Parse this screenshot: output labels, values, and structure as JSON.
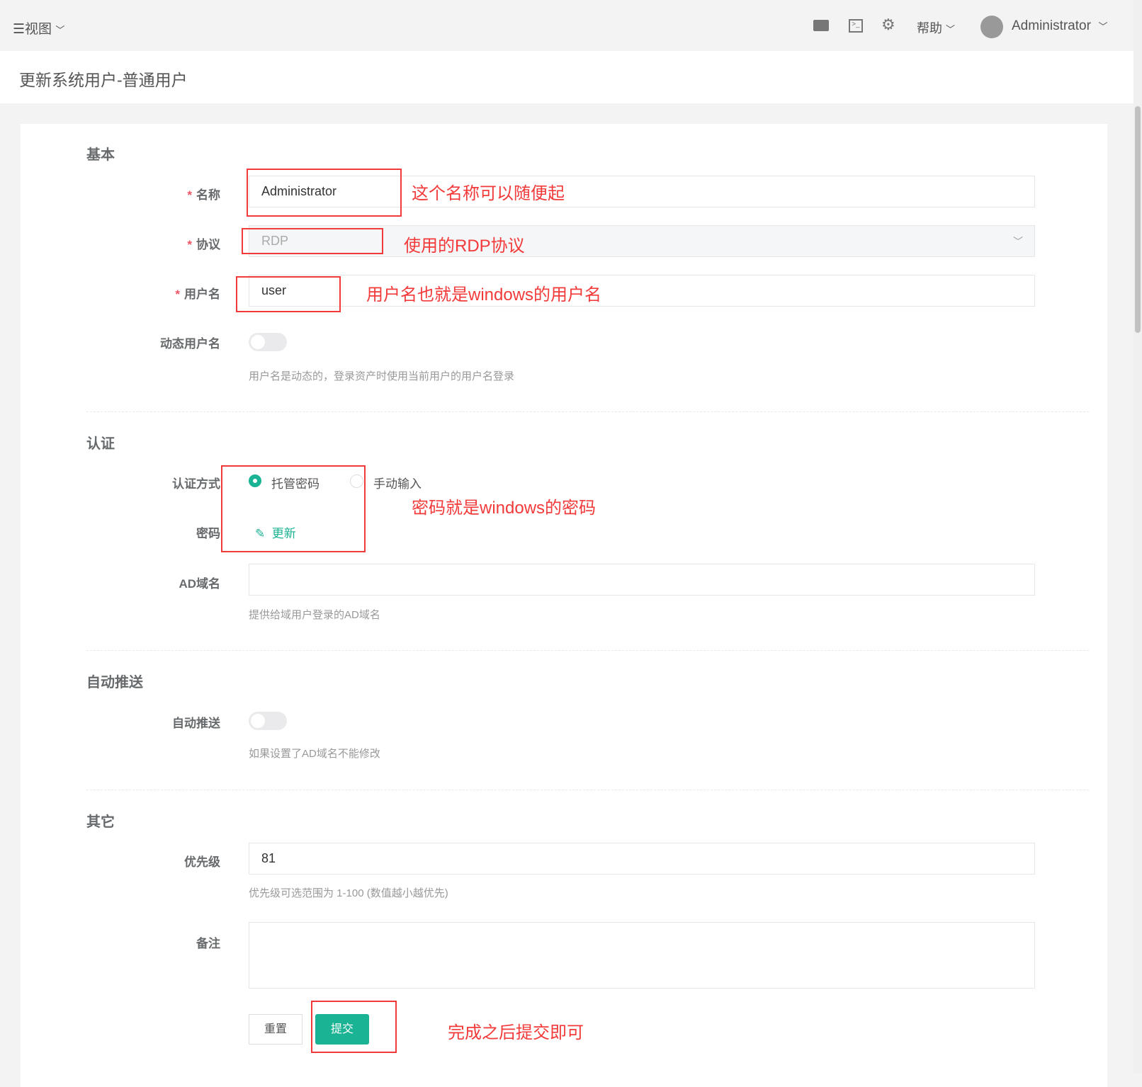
{
  "topbar": {
    "view_label": "视图",
    "help_label": "帮助",
    "user_name": "Administrator"
  },
  "page": {
    "title": "更新系统用户-普通用户"
  },
  "sections": {
    "basic": "基本",
    "auth": "认证",
    "auto_push": "自动推送",
    "other": "其它"
  },
  "form": {
    "name": {
      "label": "名称",
      "value": "Administrator"
    },
    "protocol": {
      "label": "协议",
      "value": "RDP"
    },
    "username": {
      "label": "用户名",
      "value": "user"
    },
    "dynamic_username": {
      "label": "动态用户名",
      "help": "用户名是动态的，登录资产时使用当前用户的用户名登录",
      "enabled": false
    },
    "auth_method": {
      "label": "认证方式",
      "options": [
        "托管密码",
        "手动输入"
      ],
      "selected": "托管密码"
    },
    "password": {
      "label": "密码",
      "update_label": "更新"
    },
    "ad_domain": {
      "label": "AD域名",
      "value": "",
      "help": "提供给域用户登录的AD域名"
    },
    "auto_push": {
      "label": "自动推送",
      "help": "如果设置了AD域名不能修改",
      "enabled": false
    },
    "priority": {
      "label": "优先级",
      "value": "81",
      "help": "优先级可选范围为 1-100 (数值越小越优先)"
    },
    "comment": {
      "label": "备注",
      "value": ""
    },
    "reset_label": "重置",
    "submit_label": "提交"
  },
  "annotations": {
    "name": "这个名称可以随便起",
    "protocol": "使用的RDP协议",
    "username": "用户名也就是windows的用户名",
    "password": "密码就是windows的密码",
    "submit": "完成之后提交即可"
  },
  "colors": {
    "accent": "#1ab394",
    "annotation": "#f23a3a"
  }
}
